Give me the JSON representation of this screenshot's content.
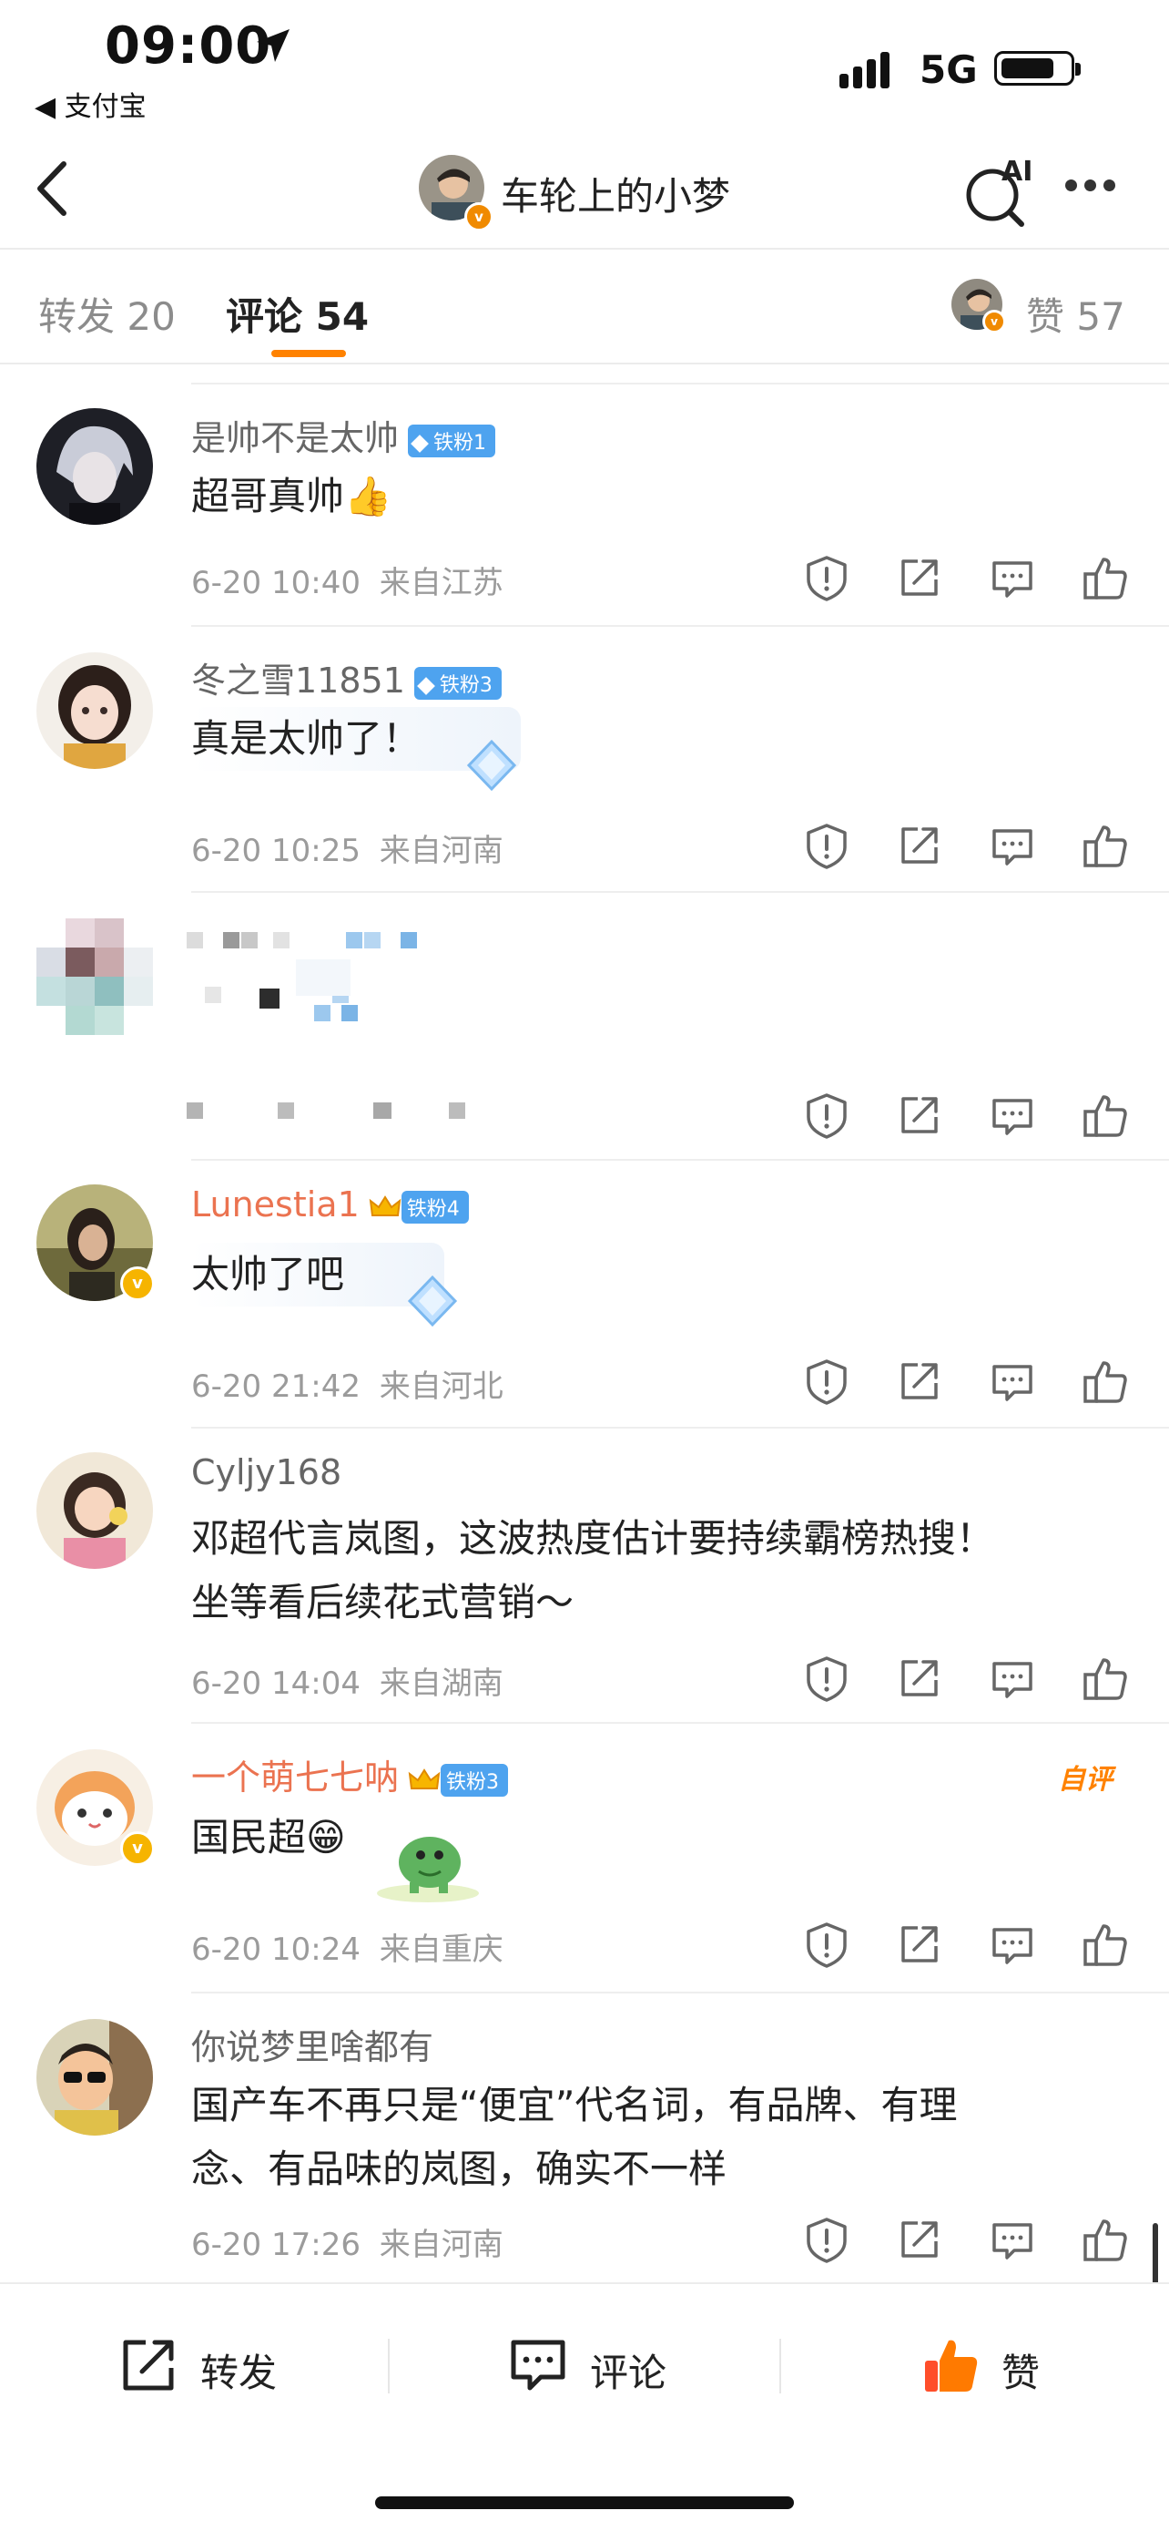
{
  "status_bar": {
    "time": "09:00",
    "back_app": "◀ 支付宝",
    "network": "5G"
  },
  "nav": {
    "title": "车轮上的小梦",
    "ai_label": "AI"
  },
  "tabs": {
    "repost_label": "转发",
    "repost_count": "20",
    "comment_label": "评论",
    "comment_count": "54",
    "like_label": "赞",
    "like_count": "57"
  },
  "comments": [
    {
      "name": "是帅不是太帅",
      "fan_badge": "铁粉1",
      "text": "超哥真帅👍",
      "time": "6-20 10:40",
      "location": "来自江苏"
    },
    {
      "name": "冬之雪11851",
      "fan_badge": "铁粉3",
      "text": "真是太帅了！",
      "time": "6-20 10:25",
      "location": "来自河南"
    },
    {
      "name": "",
      "fan_badge": "",
      "text": "",
      "time": "",
      "location": ""
    },
    {
      "name": "Lunestia1",
      "fan_badge": "铁粉4",
      "text": "太帅了吧",
      "time": "6-20 21:42",
      "location": "来自河北"
    },
    {
      "name": "Cyljy168",
      "fan_badge": "",
      "text_line1": "邓超代言岚图，这波热度估计要持续霸榜热搜！",
      "text_line2": "坐等看后续花式营销～",
      "time": "6-20 14:04",
      "location": "来自湖南"
    },
    {
      "name": "一个萌七七呐",
      "fan_badge": "铁粉3",
      "self_tag": "自评",
      "text": "国民超😁",
      "time": "6-20 10:24",
      "location": "来自重庆"
    },
    {
      "name": "你说梦里啥都有",
      "fan_badge": "",
      "text_line1": "国产车不再只是“便宜”代名词，有品牌、有理",
      "text_line2": "念、有品味的岚图，确实不一样",
      "time": "6-20 17:26",
      "location": "来自河南"
    }
  ],
  "bottom_bar": {
    "repost": "转发",
    "comment": "评论",
    "like": "赞"
  },
  "colors": {
    "accent": "#ff8200",
    "vip_name": "#eb7350",
    "fan_badge": "#4ea3ef",
    "meta_gray": "#9b9b9b"
  },
  "icons": [
    "location-arrow-icon",
    "signal-icon",
    "battery-icon",
    "back-chevron-icon",
    "ai-search-icon",
    "more-dots-icon",
    "report-icon",
    "share-icon",
    "reply-icon",
    "like-icon",
    "repost-icon",
    "comment-icon",
    "thumbs-up-icon"
  ]
}
